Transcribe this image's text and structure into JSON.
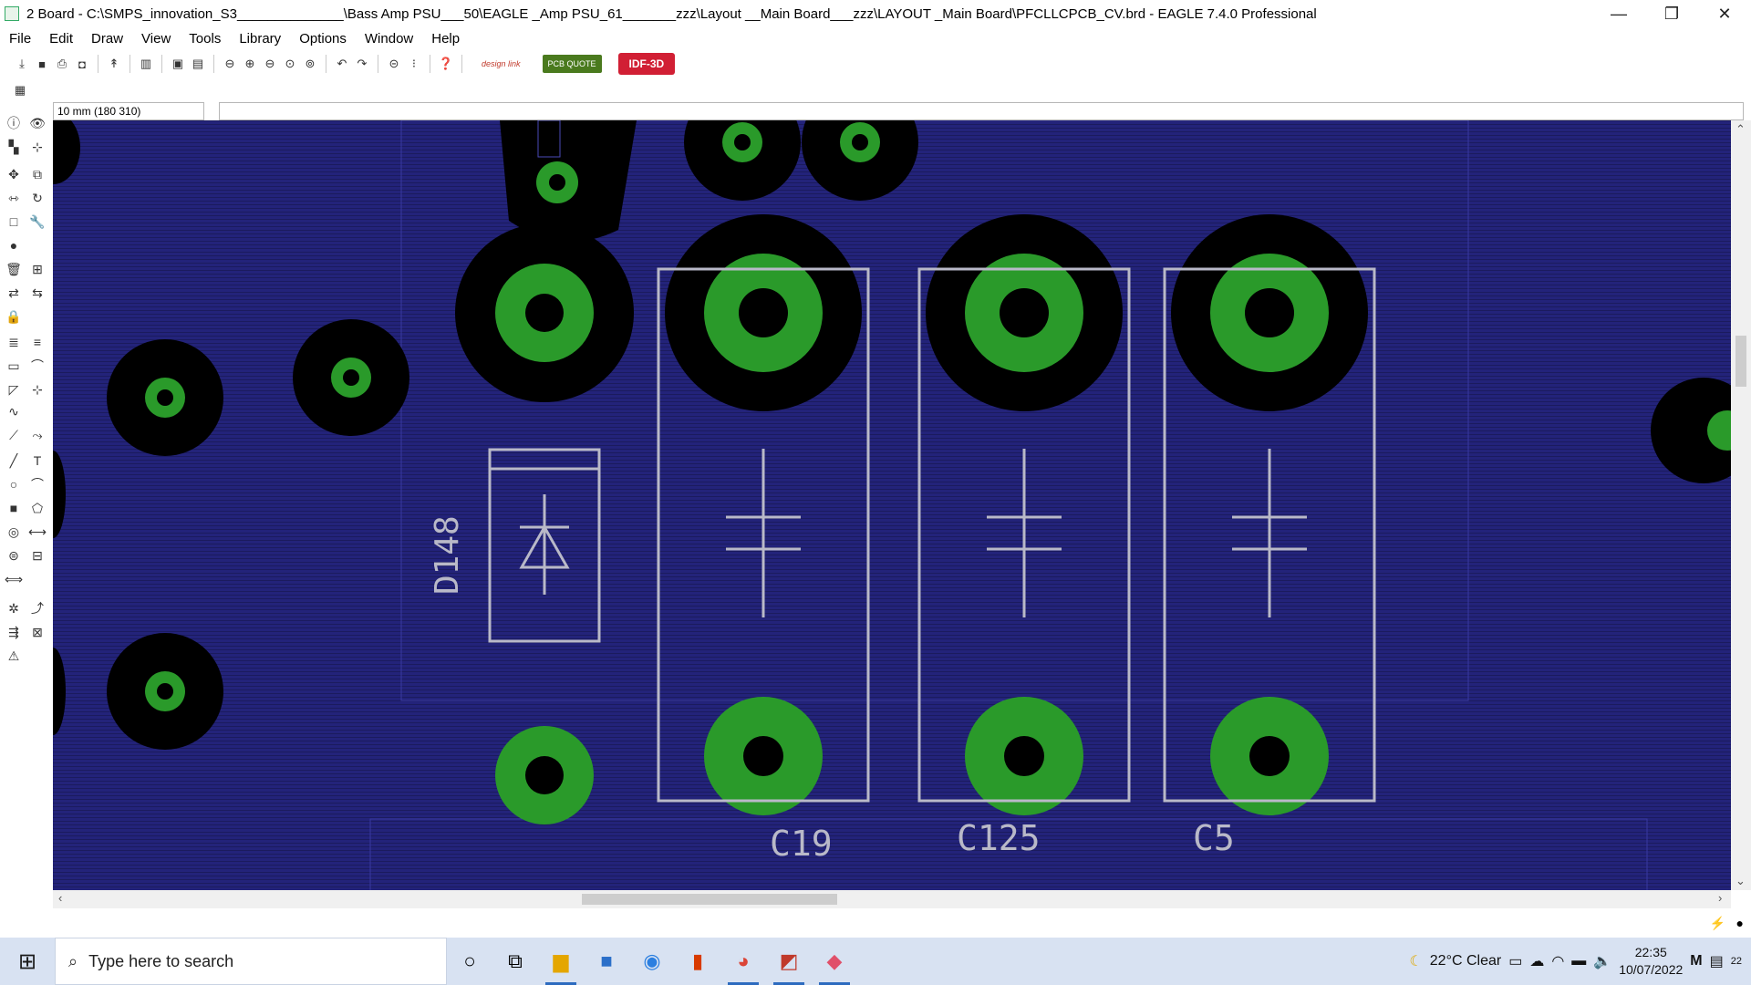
{
  "window": {
    "title": "2 Board - C:\\SMPS_innovation_S3______________\\Bass Amp PSU___50\\EAGLE _Amp PSU_61_______zzz\\Layout __Main Board___zzz\\LAYOUT _Main Board\\PFCLLCPCB_CV.brd - EAGLE 7.4.0 Professional",
    "buttons": [
      "—",
      "❐",
      "✕"
    ]
  },
  "menu": [
    "File",
    "Edit",
    "Draw",
    "View",
    "Tools",
    "Library",
    "Options",
    "Window",
    "Help"
  ],
  "toolbar": {
    "design_link_label": "design link",
    "pcb_quote_label": "PCB QUOTE",
    "idf_label": "IDF-3D"
  },
  "command": {
    "coordinate": "10 mm (180 310)",
    "input_value": ""
  },
  "board": {
    "component_labels": [
      "D148",
      "C19",
      "C125",
      "C5"
    ],
    "colors": {
      "background": "#23237a",
      "pad": "#2a9a2a",
      "copper_clear": "#000000",
      "silkscreen": "#b9b9c8"
    }
  },
  "taskbar": {
    "search_placeholder": "Type here to search",
    "weather": "22°C  Clear",
    "time": "22:35",
    "date": "10/07/2022",
    "notification_count": "22"
  }
}
